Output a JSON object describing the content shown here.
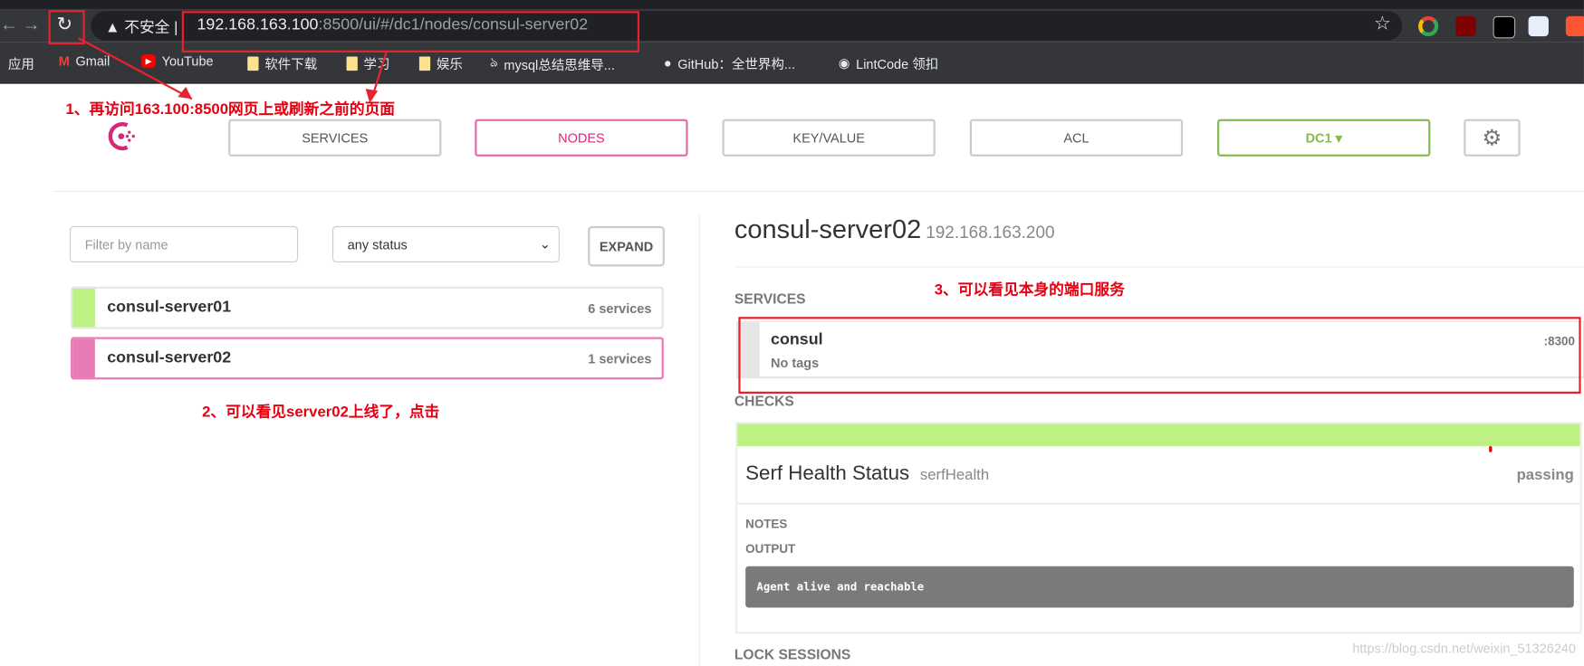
{
  "browser": {
    "security_label": "不安全",
    "url_host": "192.168.163.100",
    "url_rest": ":8500/ui/#/dc1/nodes/consul-server02",
    "bookmarks": [
      {
        "label": "应用",
        "icon": "apps-icon"
      },
      {
        "label": "Gmail",
        "icon": "gmail-icon"
      },
      {
        "label": "YouTube",
        "icon": "youtube-icon"
      },
      {
        "label": "软件下载",
        "icon": "folder-icon"
      },
      {
        "label": "学习",
        "icon": "folder-icon"
      },
      {
        "label": "娱乐",
        "icon": "folder-icon"
      },
      {
        "label": "mysql总结思维导...",
        "icon": "bookmark-icon"
      },
      {
        "label": "GitHub：全世界构...",
        "icon": "github-icon"
      },
      {
        "label": "LintCode 领扣",
        "icon": "globe-icon"
      }
    ]
  },
  "annotations": {
    "step1": "1、再访问163.100:8500网页上或刷新之前的页面",
    "step2": "2、可以看见server02上线了，点击",
    "step3": "3、可以看见本身的端口服务"
  },
  "nav": {
    "services": "SERVICES",
    "nodes": "NODES",
    "keyvalue": "KEY/VALUE",
    "acl": "ACL",
    "dc": "DC1 ▾"
  },
  "filters": {
    "name_placeholder": "Filter by name",
    "status_value": "any status",
    "expand": "EXPAND"
  },
  "nodes": [
    {
      "name": "consul-server01",
      "services": "6 services",
      "color": "#bdf184"
    },
    {
      "name": "consul-server02",
      "services": "1 services",
      "color": "#e87ab5"
    }
  ],
  "detail": {
    "name": "consul-server02",
    "address": "192.168.163.200",
    "services_label": "SERVICES",
    "service": {
      "name": "consul",
      "tags": "No tags",
      "port": ":8300"
    },
    "checks_label": "CHECKS",
    "check": {
      "name": "Serf Health Status",
      "id": "serfHealth",
      "status": "passing",
      "notes_label": "NOTES",
      "output_label": "OUTPUT",
      "output": "Agent alive and reachable"
    },
    "lock_sessions_label": "LOCK SESSIONS"
  },
  "watermark": "https://blog.csdn.net/weixin_51326240",
  "colors": {
    "accent": "#e06fa8",
    "passing": "#bdf184",
    "dc": "#86bb51"
  }
}
